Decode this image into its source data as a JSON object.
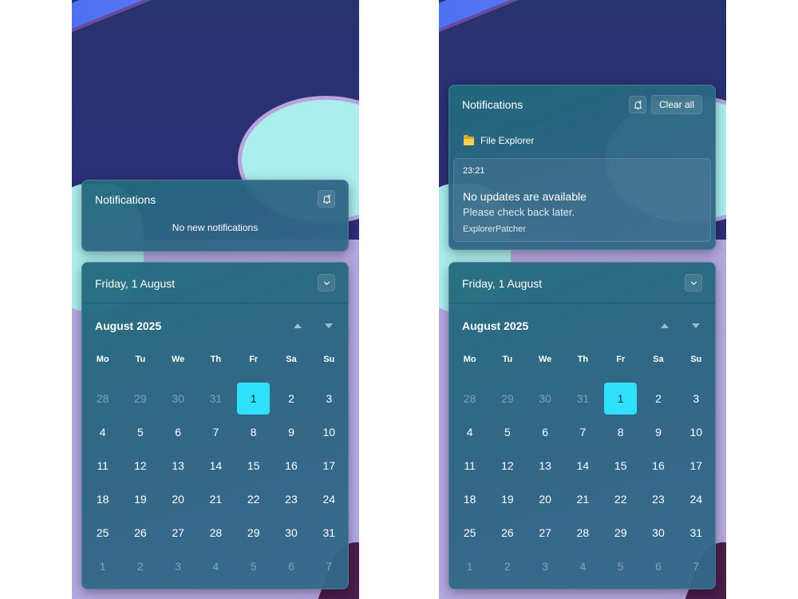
{
  "left": {
    "notifications": {
      "title": "Notifications",
      "empty_text": "No new notifications"
    },
    "calendar": {
      "date_label": "Friday, 1 August",
      "month_label": "August 2025",
      "weekdays": [
        "Mo",
        "Tu",
        "We",
        "Th",
        "Fr",
        "Sa",
        "Su"
      ],
      "weeks": [
        [
          "28",
          "29",
          "30",
          "31",
          "1",
          "2",
          "3"
        ],
        [
          "4",
          "5",
          "6",
          "7",
          "8",
          "9",
          "10"
        ],
        [
          "11",
          "12",
          "13",
          "14",
          "15",
          "16",
          "17"
        ],
        [
          "18",
          "19",
          "20",
          "21",
          "22",
          "23",
          "24"
        ],
        [
          "25",
          "26",
          "27",
          "28",
          "29",
          "30",
          "31"
        ],
        [
          "1",
          "2",
          "3",
          "4",
          "5",
          "6",
          "7"
        ]
      ]
    }
  },
  "right": {
    "notifications": {
      "title": "Notifications",
      "clear_all_label": "Clear all",
      "app_name": "File Explorer",
      "card": {
        "time": "23:21",
        "title": "No updates are available",
        "body": "Please check back later.",
        "source": "ExplorerPatcher"
      }
    },
    "calendar": {
      "date_label": "Friday, 1 August",
      "month_label": "August 2025",
      "weekdays": [
        "Mo",
        "Tu",
        "We",
        "Th",
        "Fr",
        "Sa",
        "Su"
      ],
      "weeks": [
        [
          "28",
          "29",
          "30",
          "31",
          "1",
          "2",
          "3"
        ],
        [
          "4",
          "5",
          "6",
          "7",
          "8",
          "9",
          "10"
        ],
        [
          "11",
          "12",
          "13",
          "14",
          "15",
          "16",
          "17"
        ],
        [
          "18",
          "19",
          "20",
          "21",
          "22",
          "23",
          "24"
        ],
        [
          "25",
          "26",
          "27",
          "28",
          "29",
          "30",
          "31"
        ],
        [
          "1",
          "2",
          "3",
          "4",
          "5",
          "6",
          "7"
        ]
      ]
    }
  },
  "colors": {
    "accent_today": "#2fe0fa",
    "panel": "#2e6484",
    "folder_icon": "#f8cf4f"
  },
  "icons": {
    "dnd": "bell-snooze-icon",
    "expand": "chevron-down-icon",
    "prev_month": "caret-up-icon",
    "next_month": "caret-down-icon",
    "app": "folder-icon"
  }
}
